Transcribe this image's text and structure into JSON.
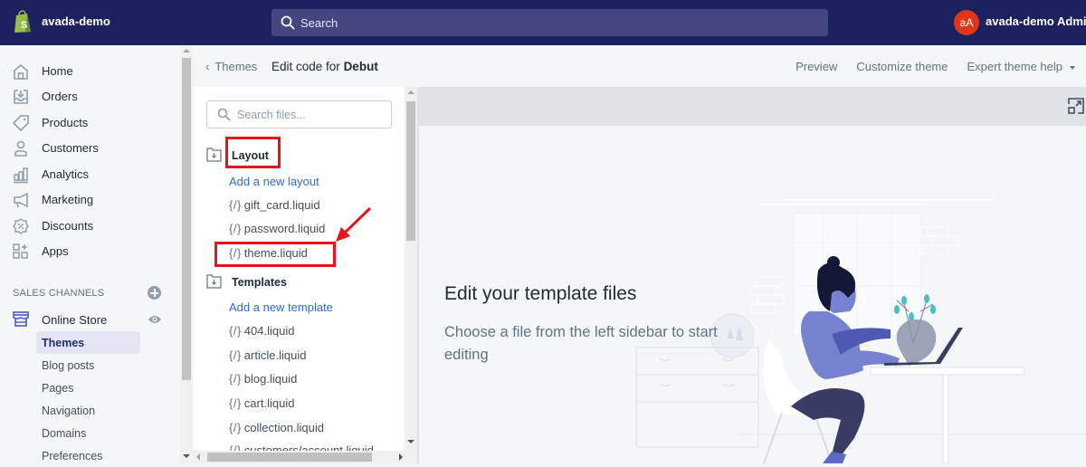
{
  "topbar": {
    "store_name": "avada-demo",
    "search_placeholder": "Search",
    "avatar_initials": "aA",
    "admin_name": "avada-demo Admin"
  },
  "nav": {
    "items": [
      {
        "label": "Home",
        "icon": "home-icon"
      },
      {
        "label": "Orders",
        "icon": "orders-icon"
      },
      {
        "label": "Products",
        "icon": "tag-icon"
      },
      {
        "label": "Customers",
        "icon": "person-icon"
      },
      {
        "label": "Analytics",
        "icon": "bar-chart-icon"
      },
      {
        "label": "Marketing",
        "icon": "megaphone-icon"
      },
      {
        "label": "Discounts",
        "icon": "discount-icon"
      },
      {
        "label": "Apps",
        "icon": "apps-icon"
      }
    ],
    "sales_channels_title": "SALES CHANNELS",
    "online_store": "Online Store",
    "online_store_sub": [
      "Themes",
      "Blog posts",
      "Pages",
      "Navigation",
      "Domains",
      "Preferences"
    ],
    "active_sub": "Themes"
  },
  "subheader": {
    "back_label": "Themes",
    "edit_prefix": "Edit code for",
    "theme_name": "Debut",
    "actions": {
      "preview": "Preview",
      "customize": "Customize theme",
      "expert_help": "Expert theme help"
    }
  },
  "file_panel": {
    "search_placeholder": "Search files...",
    "layout": {
      "title": "Layout",
      "add_link": "Add a new layout",
      "files": [
        "gift_card.liquid",
        "password.liquid",
        "theme.liquid"
      ]
    },
    "templates": {
      "title": "Templates",
      "add_link": "Add a new template",
      "files": [
        "404.liquid",
        "article.liquid",
        "blog.liquid",
        "cart.liquid",
        "collection.liquid",
        "customers/account.liquid"
      ]
    },
    "file_icon_glyph": "{/}"
  },
  "editor": {
    "empty_title": "Edit your template files",
    "empty_text": "Choose a file from the left sidebar to start editing"
  },
  "colors": {
    "topbar": "#1c2260",
    "accent_link": "#2c6ecb",
    "highlight": "#e8121a",
    "avatar": "#de3618"
  }
}
